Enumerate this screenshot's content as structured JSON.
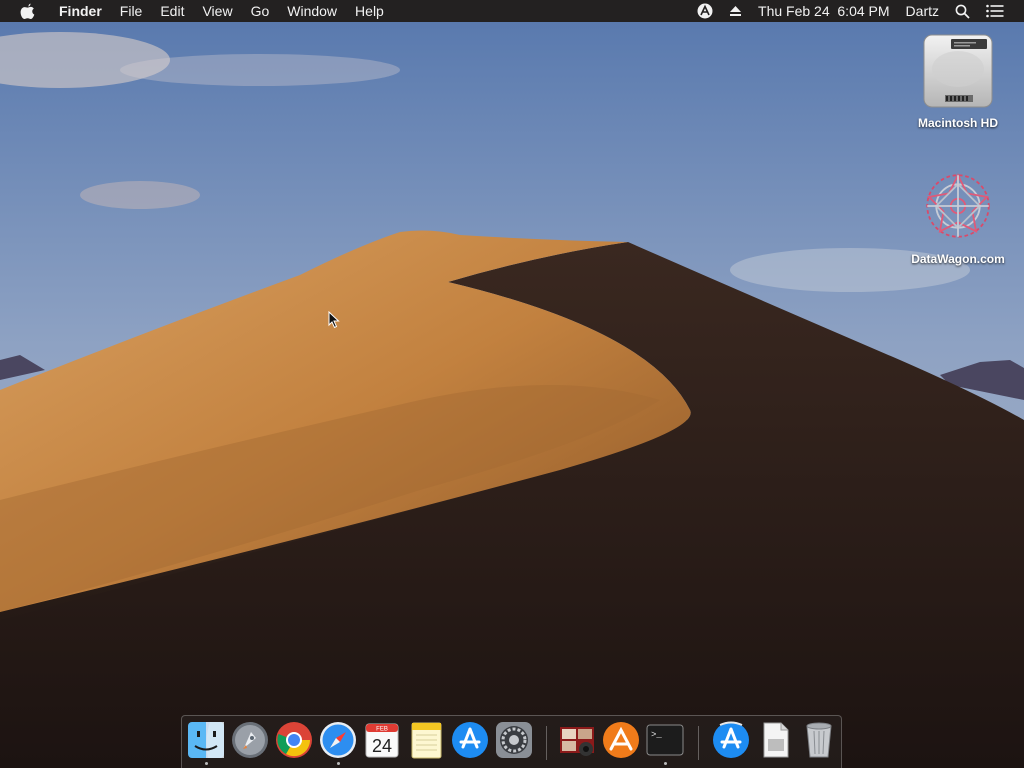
{
  "menubar": {
    "app_name": "Finder",
    "menus": [
      "File",
      "Edit",
      "View",
      "Go",
      "Window",
      "Help"
    ],
    "status": {
      "datetime": "Thu Feb 24  6:04 PM",
      "user": "Dartz"
    }
  },
  "desktop": {
    "icons": [
      {
        "label": "Macintosh HD",
        "icon": "hard-drive-icon"
      },
      {
        "label": "DataWagon.com",
        "icon": "datawagon-icon"
      }
    ]
  },
  "dock": {
    "items": [
      {
        "name": "Finder",
        "icon": "finder-icon",
        "running": true
      },
      {
        "name": "Launchpad",
        "icon": "launchpad-icon",
        "running": false
      },
      {
        "name": "Google Chrome",
        "icon": "chrome-icon",
        "running": false
      },
      {
        "name": "Safari",
        "icon": "safari-icon",
        "running": true
      },
      {
        "name": "Calendar",
        "icon": "calendar-icon",
        "running": false,
        "month": "FEB",
        "day": "24"
      },
      {
        "name": "Notes",
        "icon": "notes-icon",
        "running": false
      },
      {
        "name": "App Store",
        "icon": "app-store-icon",
        "running": false
      },
      {
        "name": "System Preferences",
        "icon": "system-preferences-icon",
        "running": false
      },
      {
        "name": "Photo Booth",
        "icon": "photo-booth-icon",
        "running": false
      },
      {
        "name": "Avast",
        "icon": "avast-icon",
        "running": false
      },
      {
        "name": "Terminal",
        "icon": "terminal-icon",
        "running": true,
        "prompt": ">_"
      },
      {
        "name": "App Store Downloads",
        "icon": "downloads-icon",
        "running": false
      },
      {
        "name": "Documents",
        "icon": "documents-icon",
        "running": false
      },
      {
        "name": "Trash",
        "icon": "trash-icon",
        "running": false
      }
    ]
  },
  "colors": {
    "menubar_bg": "#232121",
    "sky_top": "#5a7fb8",
    "sky_bottom": "#a9b6c8",
    "dune_light": "#c98f4e",
    "dune_shadow": "#2a1c17"
  }
}
